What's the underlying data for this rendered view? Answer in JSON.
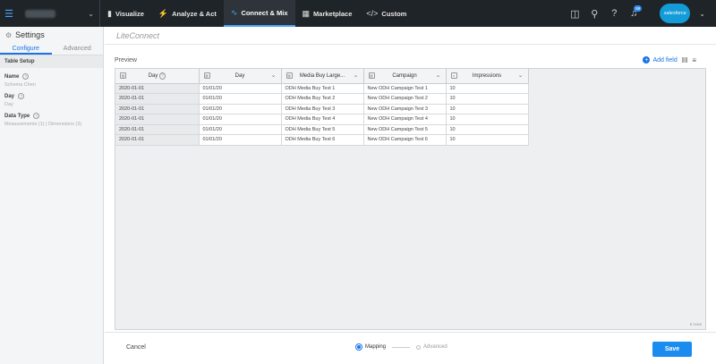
{
  "nav": {
    "tabs": [
      {
        "label": "Visualize",
        "icon": "bar-chart-icon"
      },
      {
        "label": "Analyze & Act",
        "icon": "lightning-icon"
      },
      {
        "label": "Connect & Mix",
        "icon": "connect-icon"
      },
      {
        "label": "Marketplace",
        "icon": "grid-icon"
      },
      {
        "label": "Custom",
        "icon": "code-icon"
      }
    ],
    "active_tab": "Connect & Mix",
    "notification_count": "99",
    "logo_text": "salesforce",
    "accent_color": "#4aa3ff"
  },
  "sidebar": {
    "title": "Settings",
    "tabs": [
      "Configure",
      "Advanced"
    ],
    "active_tab": "Configure",
    "section": "Table Setup",
    "fields": [
      {
        "label": "Name",
        "value": "Schema Chen"
      },
      {
        "label": "Day",
        "value": "Day"
      },
      {
        "label": "Data Type",
        "value": "Measurements (1)  |  Dimensions (3)"
      }
    ]
  },
  "main": {
    "title": "LiteConnect",
    "preview_label": "Preview",
    "add_field_label": "Add field",
    "columns": [
      "Day",
      "Day",
      "Media Buy Large...",
      "Campaign",
      "Impressions"
    ],
    "rows": [
      [
        "2020-01-01",
        "01/01/20",
        "ODH Media Buy Test 1",
        "New ODH Campaign Test 1",
        "10"
      ],
      [
        "2020-01-01",
        "01/01/20",
        "ODH Media Buy Test 2",
        "New ODH Campaign Test 2",
        "10"
      ],
      [
        "2020-01-01",
        "01/01/20",
        "ODH Media Buy Test 3",
        "New ODH Campaign Test 3",
        "10"
      ],
      [
        "2020-01-01",
        "01/01/20",
        "ODH Media Buy Test 4",
        "New ODH Campaign Test 4",
        "10"
      ],
      [
        "2020-01-01",
        "01/01/20",
        "ODH Media Buy Test 5",
        "New ODH Campaign Test 5",
        "10"
      ],
      [
        "2020-01-01",
        "01/01/20",
        "ODH Media Buy Test 6",
        "New ODH Campaign Test 6",
        "10"
      ]
    ],
    "row_count_label": "6 rows"
  },
  "footer": {
    "cancel_label": "Cancel",
    "steps": [
      "Mapping",
      "Advanced"
    ],
    "active_step": "Mapping",
    "save_label": "Save",
    "save_color": "#1a8cf0"
  }
}
